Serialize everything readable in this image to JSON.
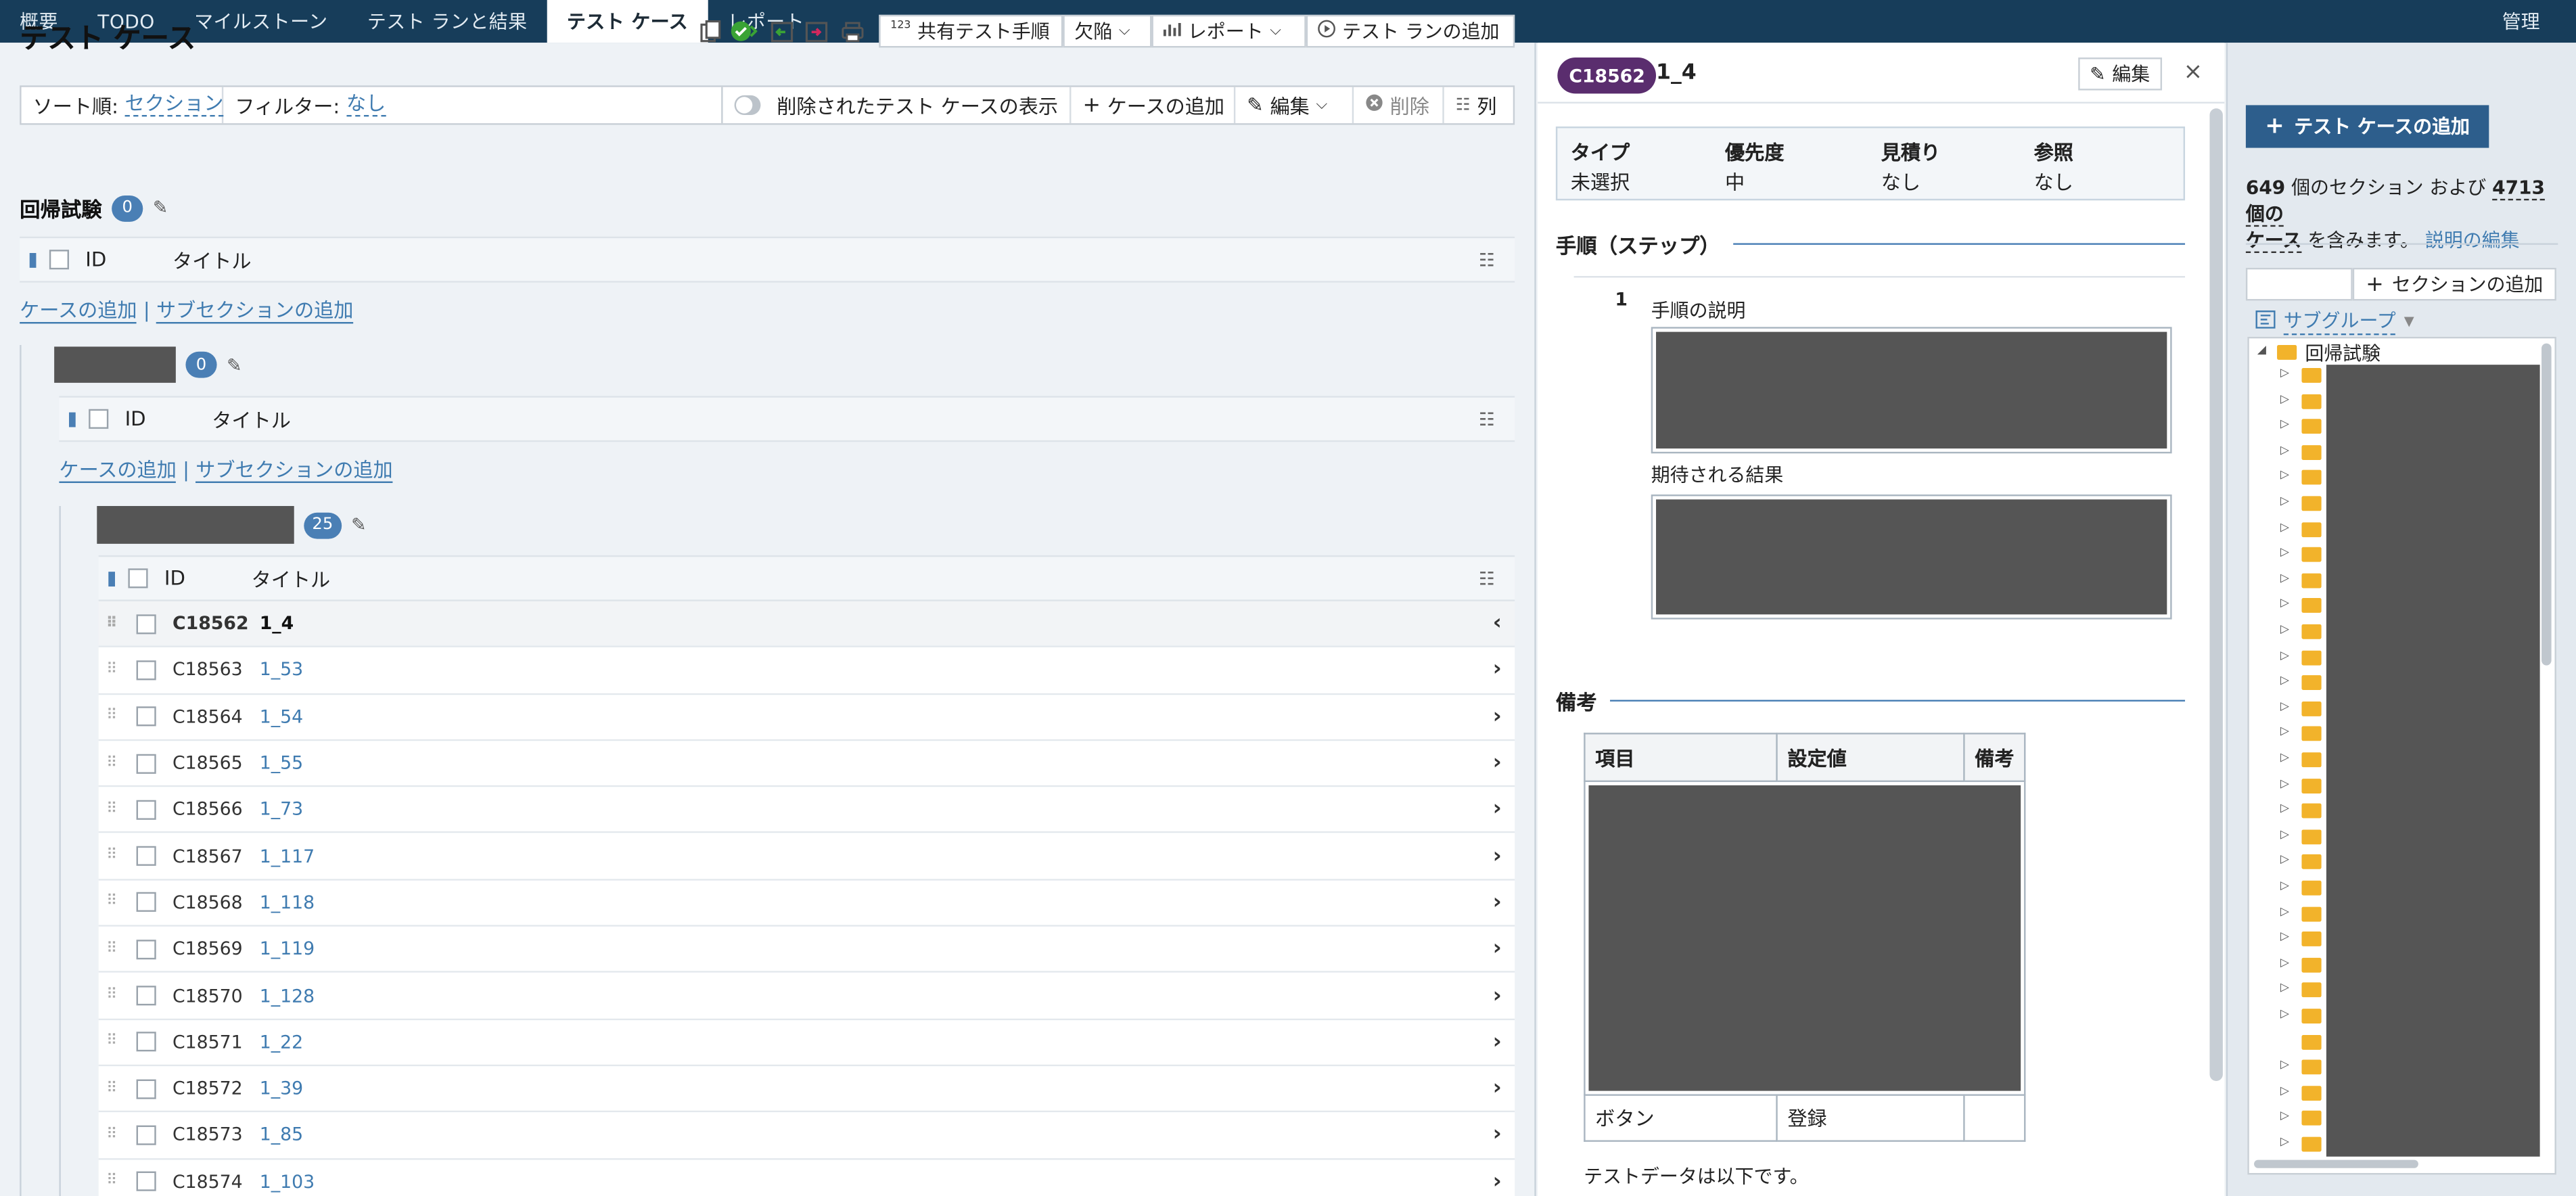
{
  "nav": {
    "tabs": [
      "概要",
      "TODO",
      "マイルストーン",
      "テスト ランと結果",
      "テスト ケース",
      "レポート"
    ],
    "active": 4,
    "admin": "管理"
  },
  "page": {
    "title": "テスト ケース"
  },
  "toolbar": {
    "shared_steps": "共有テスト手順",
    "shared_steps_icon_text": "123",
    "defects": "欠陥",
    "reports": "レポート",
    "add_run": "テスト ランの追加"
  },
  "filterbar": {
    "sort_label": "ソート順:",
    "sort_value": "セクション",
    "filter_label": "フィルター:",
    "filter_value": "なし",
    "show_deleted": "削除されたテスト ケースの表示",
    "add_case": "ケースの追加",
    "edit": "編集",
    "delete": "削除",
    "columns": "列"
  },
  "table": {
    "col_id": "ID",
    "col_title": "タイトル"
  },
  "links": {
    "add_case": "ケースの追加",
    "sep": "|",
    "add_subsection": "サブセクションの追加"
  },
  "sections": [
    {
      "title": "回帰試験",
      "count": "0"
    },
    {
      "count": "0"
    },
    {
      "count": "25"
    }
  ],
  "cases": [
    {
      "id": "C18562",
      "title": "1_4",
      "selected": true
    },
    {
      "id": "C18563",
      "title": "1_53"
    },
    {
      "id": "C18564",
      "title": "1_54"
    },
    {
      "id": "C18565",
      "title": "1_55"
    },
    {
      "id": "C18566",
      "title": "1_73"
    },
    {
      "id": "C18567",
      "title": "1_117"
    },
    {
      "id": "C18568",
      "title": "1_118"
    },
    {
      "id": "C18569",
      "title": "1_119"
    },
    {
      "id": "C18570",
      "title": "1_128"
    },
    {
      "id": "C18571",
      "title": "1_22"
    },
    {
      "id": "C18572",
      "title": "1_39"
    },
    {
      "id": "C18573",
      "title": "1_85"
    },
    {
      "id": "C18574",
      "title": "1_103"
    }
  ],
  "detail": {
    "id": "C18562",
    "title": "1_4",
    "edit": "編集",
    "close": "×",
    "info": [
      {
        "label": "タイプ",
        "value": "未選択"
      },
      {
        "label": "優先度",
        "value": "中"
      },
      {
        "label": "見積り",
        "value": "なし"
      },
      {
        "label": "参照",
        "value": "なし"
      }
    ],
    "steps_heading": "手順（ステップ）",
    "step_number": "1",
    "step_desc_label": "手順の説明",
    "expected_label": "期待される結果",
    "notes_heading": "備考",
    "notes_table": {
      "headers": [
        "項目",
        "設定値",
        "備考"
      ],
      "row": [
        "ボタン",
        "登録",
        ""
      ]
    },
    "testdata_text": "テストデータは以下です。"
  },
  "sidebar": {
    "add_case": "テスト ケースの追加",
    "sections_count": "649",
    "info_part1": "個のセクション および",
    "cases_count": "4713",
    "info_part2": "個の",
    "info_part3": "ケース",
    "info_part4": "を含みます。",
    "edit_desc": "説明の編集",
    "add_section": "セクションの追加",
    "subgroup": "サブグループ",
    "tree_root": "回帰試験"
  },
  "colors": {
    "nav_bg": "#173d5a",
    "accent": "#4a7fb5",
    "link": "#3f7bb0",
    "id_badge": "#5a2d6e",
    "primary_button": "#2d5e8c",
    "folder": "#f2b32b"
  }
}
